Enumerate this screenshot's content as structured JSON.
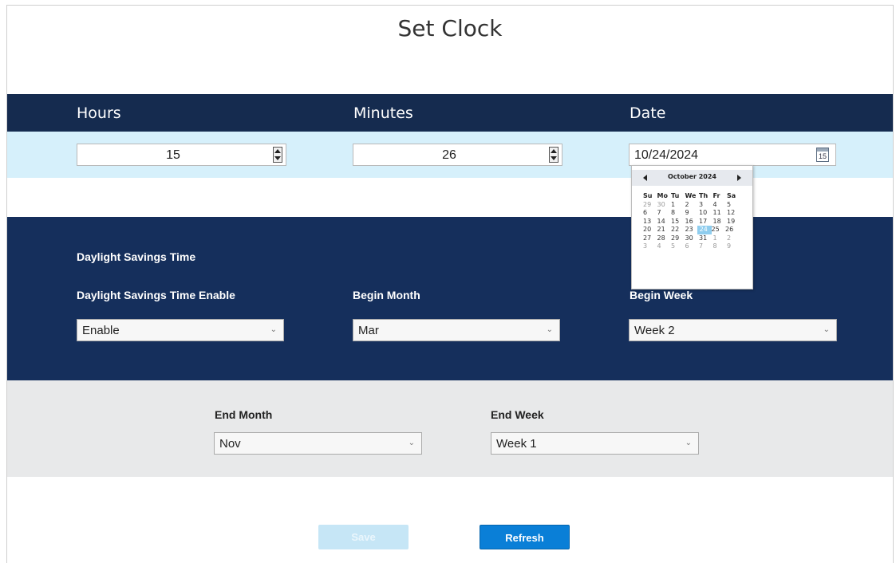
{
  "page": {
    "title": "Set Clock"
  },
  "header": {
    "hours_label": "Hours",
    "minutes_label": "Minutes",
    "date_label": "Date"
  },
  "inputs": {
    "hours_value": "15",
    "minutes_value": "26",
    "date_value": "10/24/2024",
    "calendar_icon_text": "15"
  },
  "calendar": {
    "month_label": "October 2024",
    "weekdays": [
      "Su",
      "Mo",
      "Tu",
      "We",
      "Th",
      "Fr",
      "Sa"
    ],
    "weeks": [
      [
        "29",
        "30",
        "1",
        "2",
        "3",
        "4",
        "5"
      ],
      [
        "6",
        "7",
        "8",
        "9",
        "10",
        "11",
        "12"
      ],
      [
        "13",
        "14",
        "15",
        "16",
        "17",
        "18",
        "19"
      ],
      [
        "20",
        "21",
        "22",
        "23",
        "24",
        "25",
        "26"
      ],
      [
        "27",
        "28",
        "29",
        "30",
        "31",
        "1",
        "2"
      ],
      [
        "3",
        "4",
        "5",
        "6",
        "7",
        "8",
        "9"
      ]
    ],
    "selected_day": "24"
  },
  "dst": {
    "section_title": "Daylight Savings Time",
    "enable_label": "Daylight Savings Time Enable",
    "enable_value": "Enable",
    "begin_month_label": "Begin Month",
    "begin_month_value": "Mar",
    "begin_week_label": "Begin Week",
    "begin_week_value": "Week 2",
    "end_month_label": "End Month",
    "end_month_value": "Nov",
    "end_week_label": "End Week",
    "end_week_value": "Week 1"
  },
  "actions": {
    "save_label": "Save",
    "refresh_label": "Refresh"
  },
  "colors": {
    "header_band": "#152b4f",
    "input_band": "#d6f0fb",
    "dst_band": "#152f5c",
    "end_band": "#e8e9ea",
    "refresh_button": "#0a7fd7",
    "save_button_disabled": "#c6e6f6",
    "selected_day": "#8fcdee"
  }
}
